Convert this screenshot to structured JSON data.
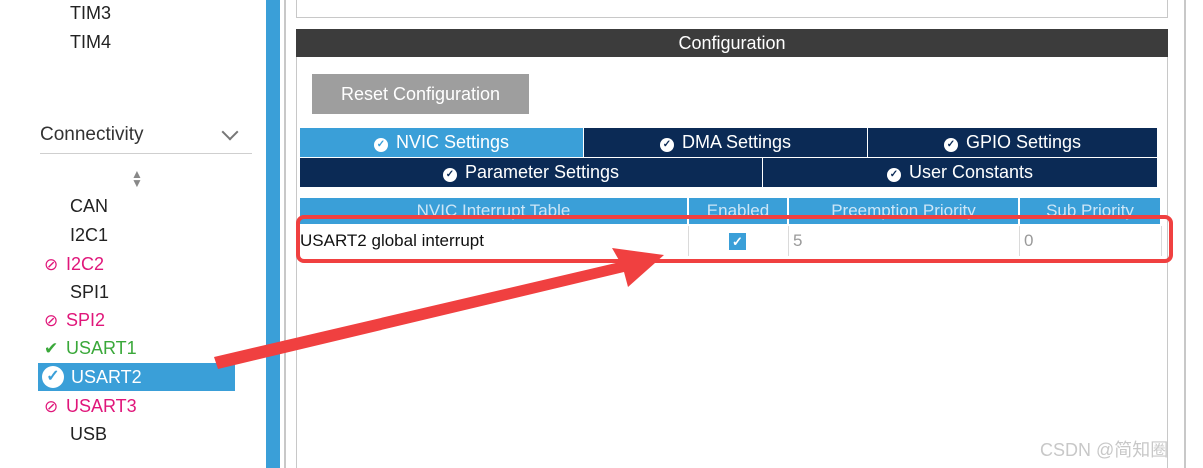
{
  "sidebar": {
    "items_top": [
      "TIM3",
      "TIM4"
    ],
    "category": {
      "label": "Connectivity"
    },
    "items": [
      {
        "label": "CAN",
        "status": "plain"
      },
      {
        "label": "I2C1",
        "status": "plain"
      },
      {
        "label": "I2C2",
        "status": "disabled"
      },
      {
        "label": "SPI1",
        "status": "plain"
      },
      {
        "label": "SPI2",
        "status": "disabled"
      },
      {
        "label": "USART1",
        "status": "configured"
      },
      {
        "label": "USART2",
        "status": "selected"
      },
      {
        "label": "USART3",
        "status": "disabled"
      },
      {
        "label": "USB",
        "status": "plain"
      }
    ]
  },
  "config": {
    "header": "Configuration",
    "reset_label": "Reset Configuration",
    "tabs": [
      {
        "label": "NVIC Settings",
        "active": true
      },
      {
        "label": "DMA Settings",
        "active": false
      },
      {
        "label": "GPIO Settings",
        "active": false
      },
      {
        "label": "Parameter Settings",
        "active": false
      },
      {
        "label": "User Constants",
        "active": false
      }
    ],
    "table": {
      "headers": [
        "NVIC Interrupt Table",
        "Enabled",
        "Preemption Priority",
        "Sub Priority"
      ],
      "rows": [
        {
          "name": "USART2 global interrupt",
          "enabled": true,
          "preemption": "5",
          "sub": "0"
        }
      ]
    }
  },
  "colors": {
    "accent": "#3a9fd8",
    "tab_dark": "#0b2a55",
    "disabled": "#e0167a",
    "configured": "#3aa83a",
    "annotation": "#f04040"
  },
  "watermark": "CSDN @简知圈"
}
